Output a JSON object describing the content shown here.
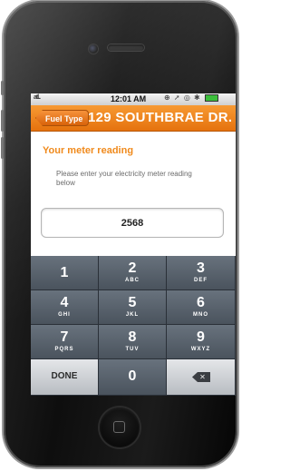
{
  "status_bar": {
    "signal": "atl..",
    "time": "12:01 AM",
    "icons": "⊕ ➚ ◎ ✱"
  },
  "nav_bar": {
    "back_label": "Fuel Type",
    "title": "129 SOUTHBRAE DR..."
  },
  "form": {
    "section_title": "Your meter reading",
    "instructions": "Please enter your electricity meter reading below",
    "reading_value": "2568"
  },
  "keypad": {
    "keys": [
      {
        "digit": "1",
        "letters": ""
      },
      {
        "digit": "2",
        "letters": "ABC"
      },
      {
        "digit": "3",
        "letters": "DEF"
      },
      {
        "digit": "4",
        "letters": "GHI"
      },
      {
        "digit": "5",
        "letters": "JKL"
      },
      {
        "digit": "6",
        "letters": "MNO"
      },
      {
        "digit": "7",
        "letters": "PQRS"
      },
      {
        "digit": "8",
        "letters": "TUV"
      },
      {
        "digit": "9",
        "letters": "WXYZ"
      },
      {
        "digit": "0",
        "letters": ""
      }
    ],
    "done_label": "DONE",
    "delete_icon": "backspace-icon"
  },
  "colors": {
    "accent": "#f08a1c",
    "nav_bar": "#e5720e",
    "keypad": "#3d4650"
  }
}
